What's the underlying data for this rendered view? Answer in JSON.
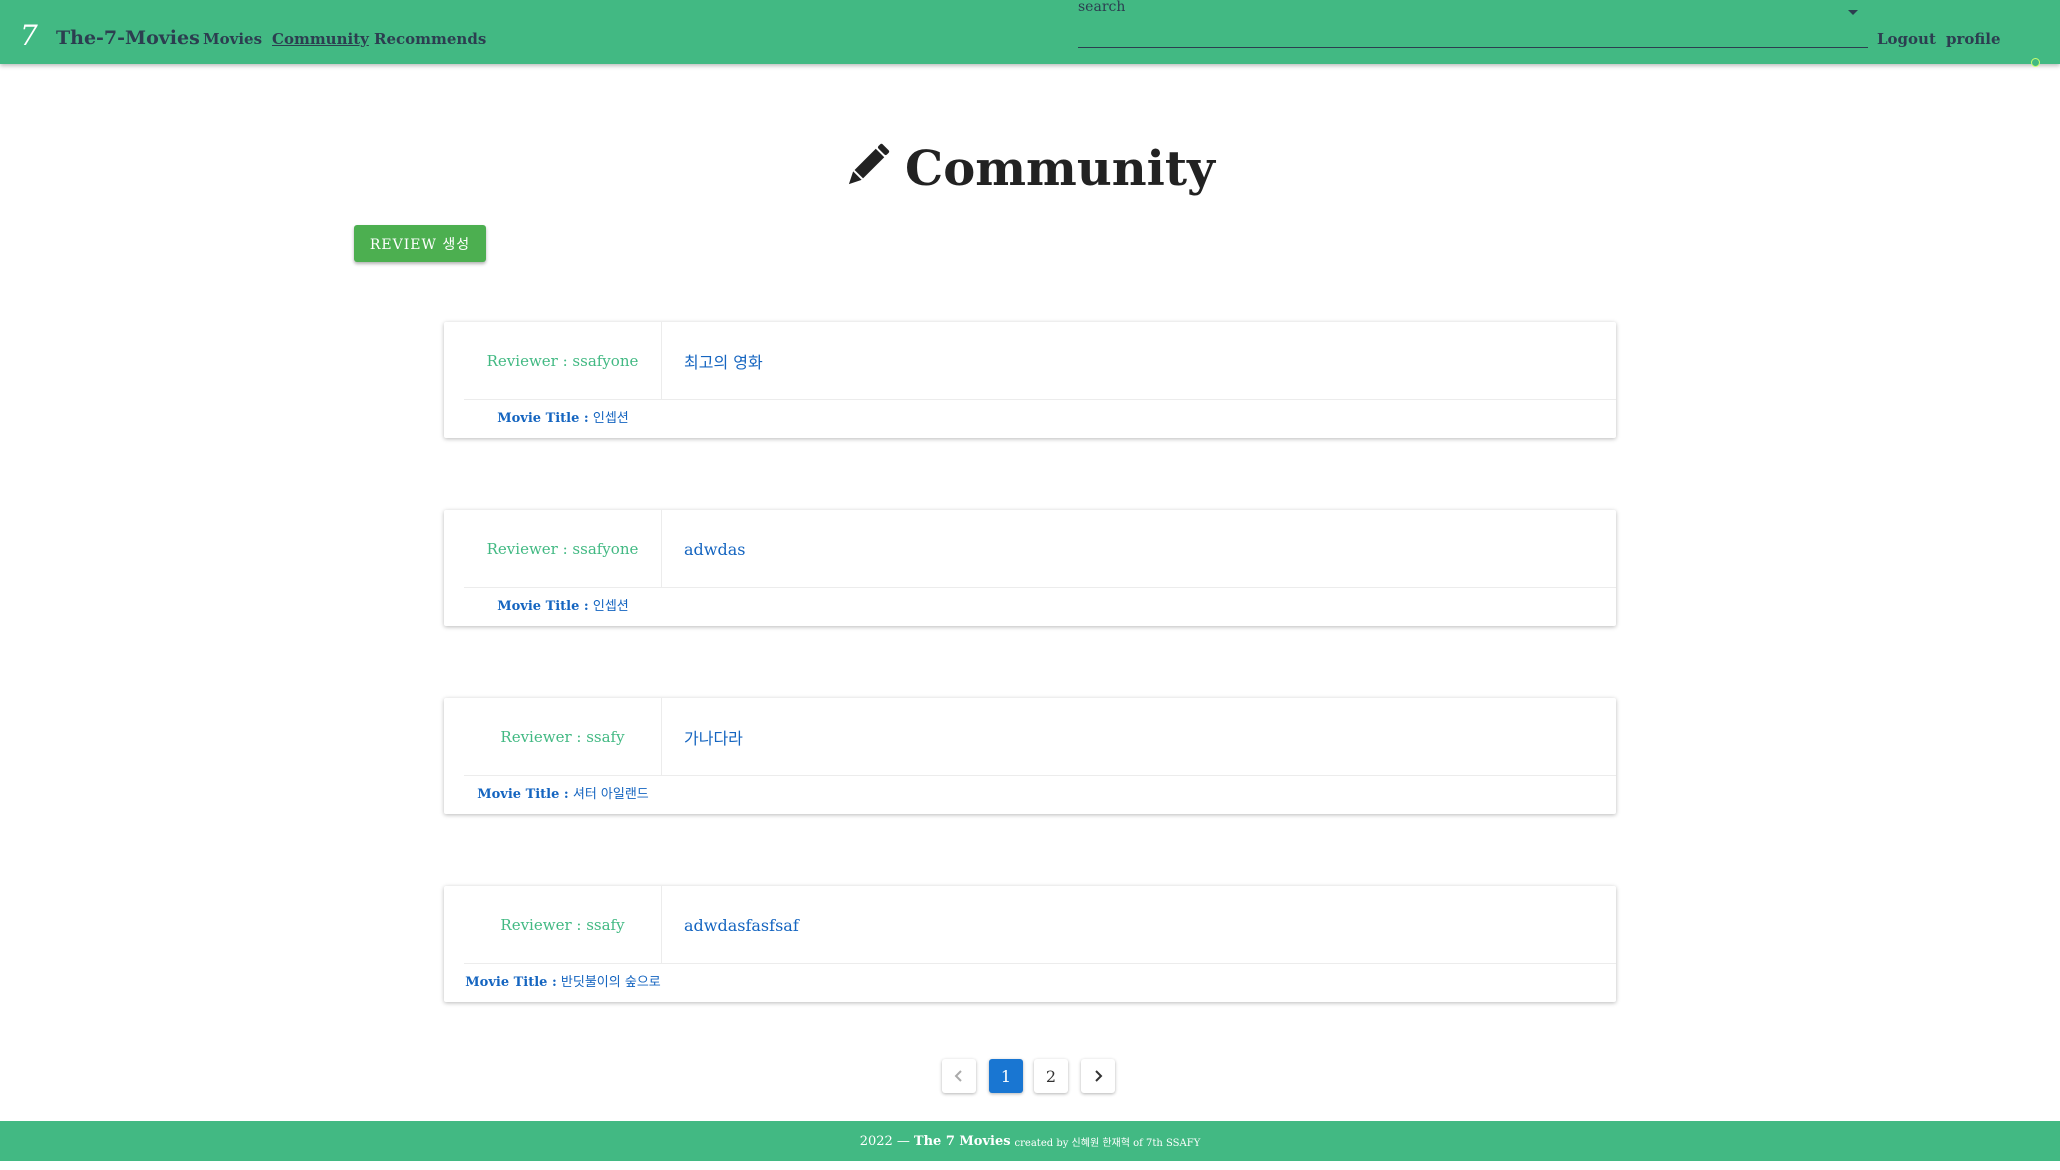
{
  "navbar": {
    "logo_mark": "7",
    "brand": "The-7-Movies",
    "links": [
      "Movies",
      "Community",
      "Recommends"
    ],
    "active_link": "Community",
    "search_label": "search",
    "search_value": "",
    "logout": "Logout",
    "profile": "profile"
  },
  "page": {
    "title": "Community",
    "create_button": "REVIEW 생성"
  },
  "reviews": [
    {
      "reviewer": "Reviewer : ssafyone",
      "title": "최고의 영화",
      "movie_label": "Movie Title :",
      "movie": "인셉션"
    },
    {
      "reviewer": "Reviewer : ssafyone",
      "title": "adwdas",
      "movie_label": "Movie Title :",
      "movie": "인셉션"
    },
    {
      "reviewer": "Reviewer : ssafy",
      "title": "가나다라",
      "movie_label": "Movie Title :",
      "movie": "셔터 아일랜드"
    },
    {
      "reviewer": "Reviewer : ssafy",
      "title": "adwdasfasfsaf",
      "movie_label": "Movie Title :",
      "movie": "반딧불이의 숲으로"
    }
  ],
  "pagination": {
    "pages": [
      "1",
      "2"
    ],
    "current": "1"
  },
  "footer": {
    "year": "2022 —",
    "name": "The 7 Movies",
    "credit": "created by 신혜원 한재혁 of 7th SSAFY"
  },
  "colors": {
    "brand_green": "#42b983",
    "button_green": "#4caf50",
    "link_blue": "#1565c0",
    "page_active": "#1976d2"
  }
}
